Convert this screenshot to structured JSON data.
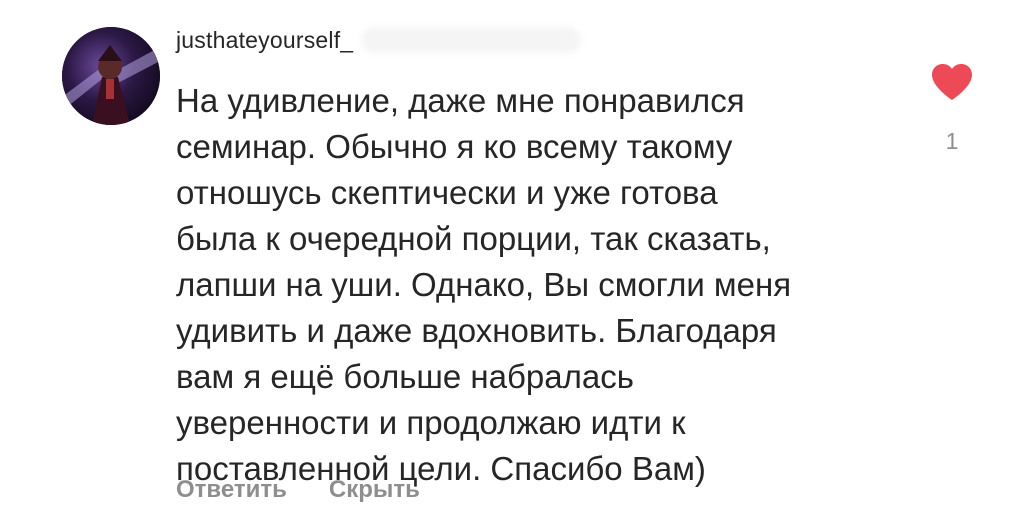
{
  "comment": {
    "username": "justhateyourself_",
    "text": "На удивление, даже мне понравился\nсеминар. Обычно я ко всему такому\nотношусь скептически и уже готова\nбыла к очередной порции, так сказать,\nлапши на уши. Однако, Вы смогли меня\nудивить и даже вдохновить. Благодаря\nвам я ещё больше набралась\nуверенности и продолжаю идти к\nпоставленной цели. Спасибо Вам)",
    "actions": {
      "reply_label": "Ответить",
      "hide_label": "Скрыть"
    },
    "likes": {
      "count": "1",
      "icon": "heart-icon",
      "liked": true,
      "color": "#ed4956"
    },
    "avatar_icon": "avatar"
  }
}
